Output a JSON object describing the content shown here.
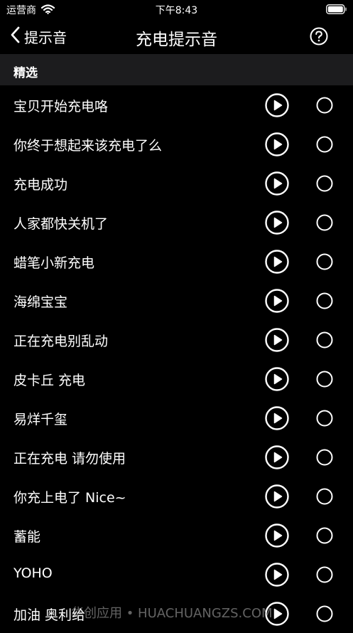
{
  "status_bar": {
    "carrier": "运营商",
    "time": "下午8:43"
  },
  "nav": {
    "back_label": "提示音",
    "title": "充电提示音"
  },
  "section": {
    "title": "精选"
  },
  "items": [
    {
      "label": "宝贝开始充电咯"
    },
    {
      "label": "你终于想起来该充电了么"
    },
    {
      "label": "充电成功"
    },
    {
      "label": "人家都快关机了"
    },
    {
      "label": "蜡笔小新充电"
    },
    {
      "label": "海绵宝宝"
    },
    {
      "label": "正在充电别乱动"
    },
    {
      "label": "皮卡丘 充电"
    },
    {
      "label": "易烊千玺"
    },
    {
      "label": "正在充电 请勿使用"
    },
    {
      "label": "你充上电了 Nice~"
    },
    {
      "label": "蓄能"
    },
    {
      "label": "YOHO"
    },
    {
      "label": "加油 奥利给"
    }
  ],
  "watermark": "华创应用 • HUACHUANGZS.COM",
  "colors": {
    "background": "#000000",
    "section_background": "#1c1c1e",
    "text": "#ffffff"
  },
  "icons": {
    "back": "chevron-left-icon",
    "help": "question-circle-icon",
    "play": "play-circle-icon",
    "radio": "radio-empty-icon",
    "wifi": "wifi-icon",
    "battery": "battery-icon"
  }
}
